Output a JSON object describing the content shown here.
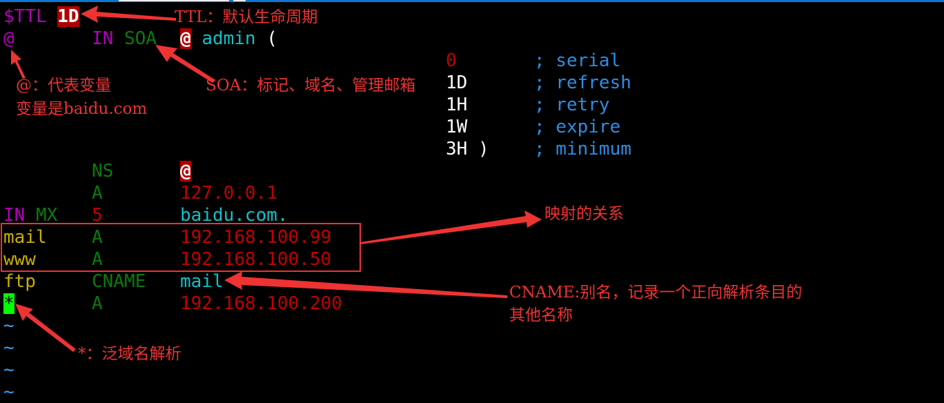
{
  "colors": {
    "annotation": "#ee3333",
    "directive": "#b000b8",
    "record_type": "#0a7a0a",
    "value_red": "#c00000",
    "value_cyan": "#10c0c8",
    "comment_blue": "#2a8ee6",
    "name_yellow": "#c8b000",
    "cursor_green": "#00ff00",
    "tilde": "#3aa0ee"
  },
  "zone": {
    "ttl_directive": "$TTL",
    "ttl_value": "1D",
    "soa_line": {
      "name": "@",
      "class": "IN",
      "type": "SOA",
      "mname": "@",
      "rname": "admin",
      "open_paren": "("
    },
    "soa_fields": [
      {
        "value": "0",
        "comment": "; serial"
      },
      {
        "value": "1D",
        "comment": "; refresh"
      },
      {
        "value": "1H",
        "comment": "; retry"
      },
      {
        "value": "1W",
        "comment": "; expire"
      },
      {
        "value": "3H )",
        "comment": "; minimum"
      }
    ],
    "records": [
      {
        "name": "",
        "class": "",
        "type": "NS",
        "priority": "",
        "data": "@"
      },
      {
        "name": "",
        "class": "",
        "type": "A",
        "priority": "",
        "data": "127.0.0.1"
      },
      {
        "name": "",
        "class": "IN",
        "type": "MX",
        "priority": "5",
        "data": "baidu.com."
      },
      {
        "name": "mail",
        "class": "",
        "type": "A",
        "priority": "",
        "data": "192.168.100.99"
      },
      {
        "name": "www",
        "class": "",
        "type": "A",
        "priority": "",
        "data": "192.168.100.50"
      },
      {
        "name": "ftp",
        "class": "",
        "type": "CNAME",
        "priority": "",
        "data": "mail"
      },
      {
        "name": "*",
        "class": "",
        "type": "A",
        "priority": "",
        "data": "192.168.100.200"
      }
    ],
    "empty_line_marker": "~"
  },
  "annotations": {
    "ttl": "TTL：默认生命周期",
    "at_line1": "@：代表变量",
    "at_line2": "变量是baidu.com",
    "soa": "SOA：标记、域名、管理邮箱",
    "mapping": "映射的关系",
    "cname_line1": "CNAME:别名，记录一个正向解析条目的",
    "cname_line2": "其他名称",
    "wildcard": "*：泛域名解析"
  }
}
